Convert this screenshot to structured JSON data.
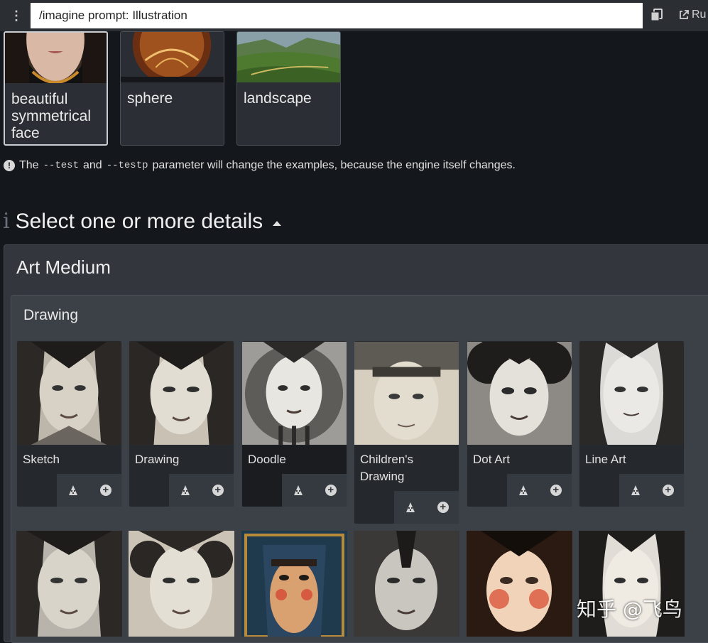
{
  "prompt": {
    "value": "/imagine prompt: Illustration",
    "menu_icon": "more-vertical-icon"
  },
  "toolbar": {
    "copy_icon": "copy-icon",
    "run_label": "Ru",
    "run_icon": "external-link-icon"
  },
  "examples": [
    {
      "label": "beautiful symmetrical face",
      "selected": true
    },
    {
      "label": "sphere",
      "selected": false
    },
    {
      "label": "landscape",
      "selected": false
    }
  ],
  "note": {
    "prefix": "The",
    "code1": "--test",
    "mid": "and",
    "code2": "--testp",
    "suffix": "parameter will change the examples, because the engine itself changes."
  },
  "details": {
    "title": "Select one or more details",
    "icon_char": "i"
  },
  "art_medium": {
    "title": "Art Medium"
  },
  "drawing": {
    "title": "Drawing",
    "items": [
      {
        "label": "Sketch"
      },
      {
        "label": "Drawing"
      },
      {
        "label": "Doodle"
      },
      {
        "label": "Children's Drawing"
      },
      {
        "label": "Dot Art"
      },
      {
        "label": "Line Art"
      }
    ]
  },
  "watermark": "知乎 @飞鸟",
  "colors": {
    "background": "#14171c",
    "panel": "#33373d",
    "card": "#25282d"
  }
}
